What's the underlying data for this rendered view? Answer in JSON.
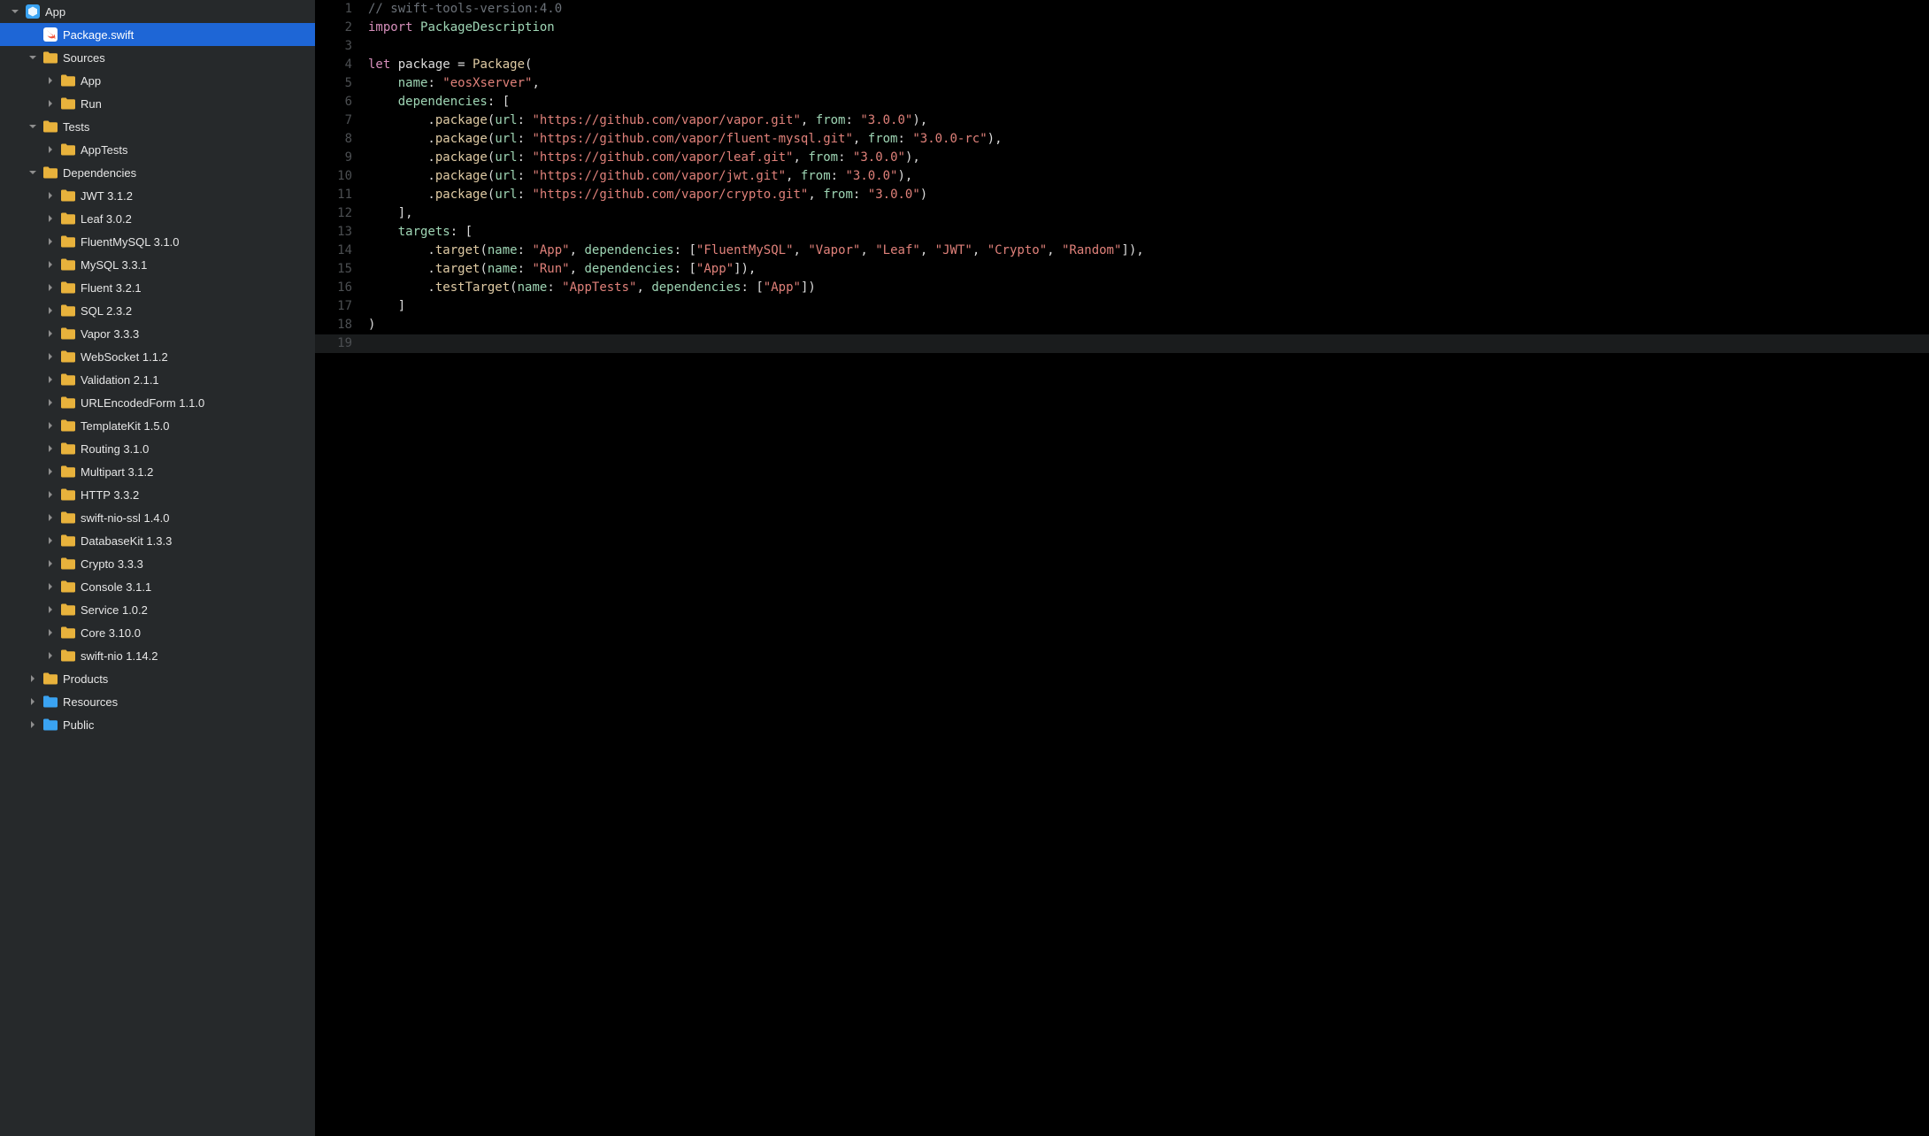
{
  "sidebar": {
    "tree": [
      {
        "indent": 0,
        "arrow": "down",
        "icon": "project",
        "label": "App",
        "selected": false
      },
      {
        "indent": 1,
        "arrow": "none",
        "icon": "swift",
        "label": "Package.swift",
        "selected": true
      },
      {
        "indent": 1,
        "arrow": "down",
        "icon": "folder-yellow",
        "label": "Sources"
      },
      {
        "indent": 2,
        "arrow": "right",
        "icon": "folder-yellow",
        "label": "App"
      },
      {
        "indent": 2,
        "arrow": "right",
        "icon": "folder-yellow",
        "label": "Run"
      },
      {
        "indent": 1,
        "arrow": "down",
        "icon": "folder-yellow",
        "label": "Tests"
      },
      {
        "indent": 2,
        "arrow": "right",
        "icon": "folder-yellow",
        "label": "AppTests"
      },
      {
        "indent": 1,
        "arrow": "down",
        "icon": "folder-yellow",
        "label": "Dependencies"
      },
      {
        "indent": 2,
        "arrow": "right",
        "icon": "folder-yellow",
        "label": "JWT 3.1.2"
      },
      {
        "indent": 2,
        "arrow": "right",
        "icon": "folder-yellow",
        "label": "Leaf 3.0.2"
      },
      {
        "indent": 2,
        "arrow": "right",
        "icon": "folder-yellow",
        "label": "FluentMySQL 3.1.0"
      },
      {
        "indent": 2,
        "arrow": "right",
        "icon": "folder-yellow",
        "label": "MySQL 3.3.1"
      },
      {
        "indent": 2,
        "arrow": "right",
        "icon": "folder-yellow",
        "label": "Fluent 3.2.1"
      },
      {
        "indent": 2,
        "arrow": "right",
        "icon": "folder-yellow",
        "label": "SQL 2.3.2"
      },
      {
        "indent": 2,
        "arrow": "right",
        "icon": "folder-yellow",
        "label": "Vapor 3.3.3"
      },
      {
        "indent": 2,
        "arrow": "right",
        "icon": "folder-yellow",
        "label": "WebSocket 1.1.2"
      },
      {
        "indent": 2,
        "arrow": "right",
        "icon": "folder-yellow",
        "label": "Validation 2.1.1"
      },
      {
        "indent": 2,
        "arrow": "right",
        "icon": "folder-yellow",
        "label": "URLEncodedForm 1.1.0"
      },
      {
        "indent": 2,
        "arrow": "right",
        "icon": "folder-yellow",
        "label": "TemplateKit 1.5.0"
      },
      {
        "indent": 2,
        "arrow": "right",
        "icon": "folder-yellow",
        "label": "Routing 3.1.0"
      },
      {
        "indent": 2,
        "arrow": "right",
        "icon": "folder-yellow",
        "label": "Multipart 3.1.2"
      },
      {
        "indent": 2,
        "arrow": "right",
        "icon": "folder-yellow",
        "label": "HTTP 3.3.2"
      },
      {
        "indent": 2,
        "arrow": "right",
        "icon": "folder-yellow",
        "label": "swift-nio-ssl 1.4.0"
      },
      {
        "indent": 2,
        "arrow": "right",
        "icon": "folder-yellow",
        "label": "DatabaseKit 1.3.3"
      },
      {
        "indent": 2,
        "arrow": "right",
        "icon": "folder-yellow",
        "label": "Crypto 3.3.3"
      },
      {
        "indent": 2,
        "arrow": "right",
        "icon": "folder-yellow",
        "label": "Console 3.1.1"
      },
      {
        "indent": 2,
        "arrow": "right",
        "icon": "folder-yellow",
        "label": "Service 1.0.2"
      },
      {
        "indent": 2,
        "arrow": "right",
        "icon": "folder-yellow",
        "label": "Core 3.10.0"
      },
      {
        "indent": 2,
        "arrow": "right",
        "icon": "folder-yellow",
        "label": "swift-nio 1.14.2"
      },
      {
        "indent": 1,
        "arrow": "right",
        "icon": "folder-yellow",
        "label": "Products"
      },
      {
        "indent": 1,
        "arrow": "right",
        "icon": "folder-blue",
        "label": "Resources"
      },
      {
        "indent": 1,
        "arrow": "right",
        "icon": "folder-blue",
        "label": "Public"
      }
    ]
  },
  "editor": {
    "current_line": 19,
    "lines": [
      {
        "n": 1,
        "tokens": [
          {
            "t": "// swift-tools-version:4.0",
            "c": "comment"
          }
        ]
      },
      {
        "n": 2,
        "tokens": [
          {
            "t": "import",
            "c": "keyword"
          },
          {
            "t": " ",
            "c": "punct"
          },
          {
            "t": "PackageDescription",
            "c": "type"
          }
        ]
      },
      {
        "n": 3,
        "tokens": []
      },
      {
        "n": 4,
        "tokens": [
          {
            "t": "let",
            "c": "keyword"
          },
          {
            "t": " package = ",
            "c": "punct"
          },
          {
            "t": "Package",
            "c": "func"
          },
          {
            "t": "(",
            "c": "punct"
          }
        ]
      },
      {
        "n": 5,
        "tokens": [
          {
            "t": "    ",
            "c": "punct"
          },
          {
            "t": "name",
            "c": "label"
          },
          {
            "t": ": ",
            "c": "punct"
          },
          {
            "t": "\"eosXserver\"",
            "c": "string"
          },
          {
            "t": ",",
            "c": "punct"
          }
        ]
      },
      {
        "n": 6,
        "tokens": [
          {
            "t": "    ",
            "c": "punct"
          },
          {
            "t": "dependencies",
            "c": "label"
          },
          {
            "t": ": [",
            "c": "punct"
          }
        ]
      },
      {
        "n": 7,
        "tokens": [
          {
            "t": "        .",
            "c": "punct"
          },
          {
            "t": "package",
            "c": "func"
          },
          {
            "t": "(",
            "c": "punct"
          },
          {
            "t": "url",
            "c": "label"
          },
          {
            "t": ": ",
            "c": "punct"
          },
          {
            "t": "\"https://github.com/vapor/vapor.git\"",
            "c": "string"
          },
          {
            "t": ", ",
            "c": "punct"
          },
          {
            "t": "from",
            "c": "label"
          },
          {
            "t": ": ",
            "c": "punct"
          },
          {
            "t": "\"3.0.0\"",
            "c": "string"
          },
          {
            "t": "),",
            "c": "punct"
          }
        ]
      },
      {
        "n": 8,
        "tokens": [
          {
            "t": "        .",
            "c": "punct"
          },
          {
            "t": "package",
            "c": "func"
          },
          {
            "t": "(",
            "c": "punct"
          },
          {
            "t": "url",
            "c": "label"
          },
          {
            "t": ": ",
            "c": "punct"
          },
          {
            "t": "\"https://github.com/vapor/fluent-mysql.git\"",
            "c": "string"
          },
          {
            "t": ", ",
            "c": "punct"
          },
          {
            "t": "from",
            "c": "label"
          },
          {
            "t": ": ",
            "c": "punct"
          },
          {
            "t": "\"3.0.0-rc\"",
            "c": "string"
          },
          {
            "t": "),",
            "c": "punct"
          }
        ]
      },
      {
        "n": 9,
        "tokens": [
          {
            "t": "        .",
            "c": "punct"
          },
          {
            "t": "package",
            "c": "func"
          },
          {
            "t": "(",
            "c": "punct"
          },
          {
            "t": "url",
            "c": "label"
          },
          {
            "t": ": ",
            "c": "punct"
          },
          {
            "t": "\"https://github.com/vapor/leaf.git\"",
            "c": "string"
          },
          {
            "t": ", ",
            "c": "punct"
          },
          {
            "t": "from",
            "c": "label"
          },
          {
            "t": ": ",
            "c": "punct"
          },
          {
            "t": "\"3.0.0\"",
            "c": "string"
          },
          {
            "t": "),",
            "c": "punct"
          }
        ]
      },
      {
        "n": 10,
        "tokens": [
          {
            "t": "        .",
            "c": "punct"
          },
          {
            "t": "package",
            "c": "func"
          },
          {
            "t": "(",
            "c": "punct"
          },
          {
            "t": "url",
            "c": "label"
          },
          {
            "t": ": ",
            "c": "punct"
          },
          {
            "t": "\"https://github.com/vapor/jwt.git\"",
            "c": "string"
          },
          {
            "t": ", ",
            "c": "punct"
          },
          {
            "t": "from",
            "c": "label"
          },
          {
            "t": ": ",
            "c": "punct"
          },
          {
            "t": "\"3.0.0\"",
            "c": "string"
          },
          {
            "t": "),",
            "c": "punct"
          }
        ]
      },
      {
        "n": 11,
        "tokens": [
          {
            "t": "        .",
            "c": "punct"
          },
          {
            "t": "package",
            "c": "func"
          },
          {
            "t": "(",
            "c": "punct"
          },
          {
            "t": "url",
            "c": "label"
          },
          {
            "t": ": ",
            "c": "punct"
          },
          {
            "t": "\"https://github.com/vapor/crypto.git\"",
            "c": "string"
          },
          {
            "t": ", ",
            "c": "punct"
          },
          {
            "t": "from",
            "c": "label"
          },
          {
            "t": ": ",
            "c": "punct"
          },
          {
            "t": "\"3.0.0\"",
            "c": "string"
          },
          {
            "t": ")",
            "c": "punct"
          }
        ]
      },
      {
        "n": 12,
        "tokens": [
          {
            "t": "    ],",
            "c": "punct"
          }
        ]
      },
      {
        "n": 13,
        "tokens": [
          {
            "t": "    ",
            "c": "punct"
          },
          {
            "t": "targets",
            "c": "label"
          },
          {
            "t": ": [",
            "c": "punct"
          }
        ]
      },
      {
        "n": 14,
        "tokens": [
          {
            "t": "        .",
            "c": "punct"
          },
          {
            "t": "target",
            "c": "func"
          },
          {
            "t": "(",
            "c": "punct"
          },
          {
            "t": "name",
            "c": "label"
          },
          {
            "t": ": ",
            "c": "punct"
          },
          {
            "t": "\"App\"",
            "c": "string"
          },
          {
            "t": ", ",
            "c": "punct"
          },
          {
            "t": "dependencies",
            "c": "label"
          },
          {
            "t": ": [",
            "c": "punct"
          },
          {
            "t": "\"FluentMySQL\"",
            "c": "string"
          },
          {
            "t": ", ",
            "c": "punct"
          },
          {
            "t": "\"Vapor\"",
            "c": "string"
          },
          {
            "t": ", ",
            "c": "punct"
          },
          {
            "t": "\"Leaf\"",
            "c": "string"
          },
          {
            "t": ", ",
            "c": "punct"
          },
          {
            "t": "\"JWT\"",
            "c": "string"
          },
          {
            "t": ", ",
            "c": "punct"
          },
          {
            "t": "\"Crypto\"",
            "c": "string"
          },
          {
            "t": ", ",
            "c": "punct"
          },
          {
            "t": "\"Random\"",
            "c": "string"
          },
          {
            "t": "]),",
            "c": "punct"
          }
        ]
      },
      {
        "n": 15,
        "tokens": [
          {
            "t": "        .",
            "c": "punct"
          },
          {
            "t": "target",
            "c": "func"
          },
          {
            "t": "(",
            "c": "punct"
          },
          {
            "t": "name",
            "c": "label"
          },
          {
            "t": ": ",
            "c": "punct"
          },
          {
            "t": "\"Run\"",
            "c": "string"
          },
          {
            "t": ", ",
            "c": "punct"
          },
          {
            "t": "dependencies",
            "c": "label"
          },
          {
            "t": ": [",
            "c": "punct"
          },
          {
            "t": "\"App\"",
            "c": "string"
          },
          {
            "t": "]),",
            "c": "punct"
          }
        ]
      },
      {
        "n": 16,
        "tokens": [
          {
            "t": "        .",
            "c": "punct"
          },
          {
            "t": "testTarget",
            "c": "func"
          },
          {
            "t": "(",
            "c": "punct"
          },
          {
            "t": "name",
            "c": "label"
          },
          {
            "t": ": ",
            "c": "punct"
          },
          {
            "t": "\"AppTests\"",
            "c": "string"
          },
          {
            "t": ", ",
            "c": "punct"
          },
          {
            "t": "dependencies",
            "c": "label"
          },
          {
            "t": ": [",
            "c": "punct"
          },
          {
            "t": "\"App\"",
            "c": "string"
          },
          {
            "t": "])",
            "c": "punct"
          }
        ]
      },
      {
        "n": 17,
        "tokens": [
          {
            "t": "    ]",
            "c": "punct"
          }
        ]
      },
      {
        "n": 18,
        "tokens": [
          {
            "t": ")",
            "c": "punct"
          }
        ]
      },
      {
        "n": 19,
        "tokens": []
      }
    ]
  }
}
